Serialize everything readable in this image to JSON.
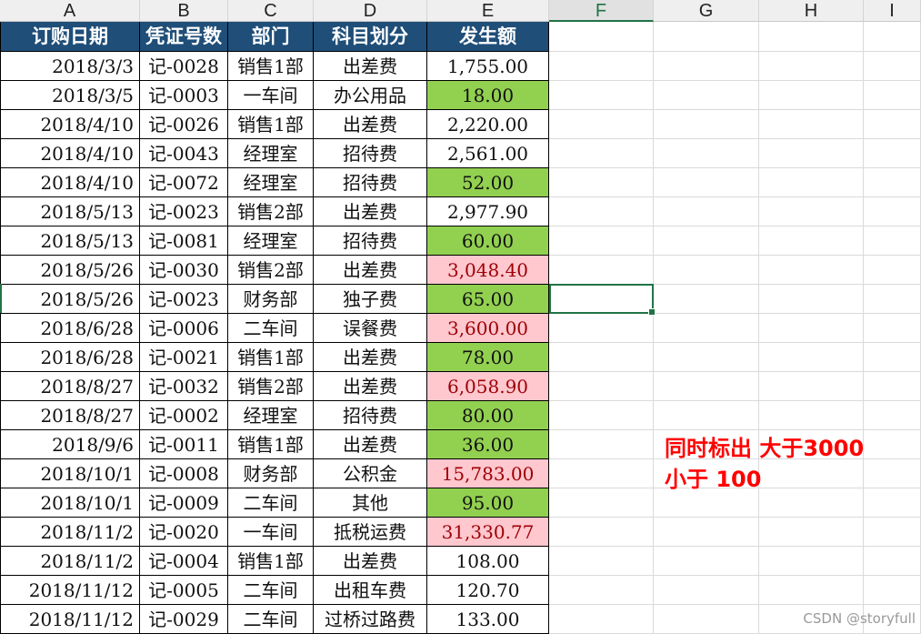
{
  "columns": [
    "A",
    "B",
    "C",
    "D",
    "E",
    "F",
    "G",
    "H",
    "I"
  ],
  "selected_column": "F",
  "header": [
    "订购日期",
    "凭证号数",
    "部门",
    "科目划分",
    "发生额"
  ],
  "rows": [
    [
      "2018/3/3",
      "记-0028",
      "销售1部",
      "出差费",
      "1,755.00",
      ""
    ],
    [
      "2018/3/5",
      "记-0003",
      "一车间",
      "办公用品",
      "18.00",
      "low"
    ],
    [
      "2018/4/10",
      "记-0026",
      "销售1部",
      "出差费",
      "2,220.00",
      ""
    ],
    [
      "2018/4/10",
      "记-0043",
      "经理室",
      "招待费",
      "2,561.00",
      ""
    ],
    [
      "2018/4/10",
      "记-0072",
      "经理室",
      "招待费",
      "52.00",
      "low"
    ],
    [
      "2018/5/13",
      "记-0023",
      "销售2部",
      "出差费",
      "2,977.90",
      ""
    ],
    [
      "2018/5/13",
      "记-0081",
      "经理室",
      "招待费",
      "60.00",
      "low"
    ],
    [
      "2018/5/26",
      "记-0030",
      "销售2部",
      "出差费",
      "3,048.40",
      "high"
    ],
    [
      "2018/5/26",
      "记-0023",
      "财务部",
      "独子费",
      "65.00",
      "low"
    ],
    [
      "2018/6/28",
      "记-0006",
      "二车间",
      "误餐费",
      "3,600.00",
      "high"
    ],
    [
      "2018/6/28",
      "记-0021",
      "销售1部",
      "出差费",
      "78.00",
      "low"
    ],
    [
      "2018/8/27",
      "记-0032",
      "销售2部",
      "出差费",
      "6,058.90",
      "high"
    ],
    [
      "2018/8/27",
      "记-0002",
      "经理室",
      "招待费",
      "80.00",
      "low"
    ],
    [
      "2018/9/6",
      "记-0011",
      "销售1部",
      "出差费",
      "36.00",
      "low"
    ],
    [
      "2018/10/1",
      "记-0008",
      "财务部",
      "公积金",
      "15,783.00",
      "high"
    ],
    [
      "2018/10/1",
      "记-0009",
      "二车间",
      "其他",
      "95.00",
      "low"
    ],
    [
      "2018/11/2",
      "记-0020",
      "一车间",
      "抵税运费",
      "31,330.77",
      "high"
    ],
    [
      "2018/11/2",
      "记-0004",
      "销售1部",
      "出差费",
      "108.00",
      ""
    ],
    [
      "2018/11/12",
      "记-0005",
      "二车间",
      "出租车费",
      "120.70",
      ""
    ],
    [
      "2018/11/12",
      "记-0029",
      "二车间",
      "过桥过路费",
      "133.00",
      ""
    ]
  ],
  "colors": {
    "header_bg": "#1f4e78",
    "low_fill": "#92d050",
    "high_fill": "#ffc7ce",
    "high_text": "#9c0006",
    "selection": "#217346",
    "note_text": "#ff0000"
  },
  "note": {
    "line1": "同时标出 大于3000",
    "line2": "小于 100"
  },
  "watermark": "CSDN @storyfull"
}
